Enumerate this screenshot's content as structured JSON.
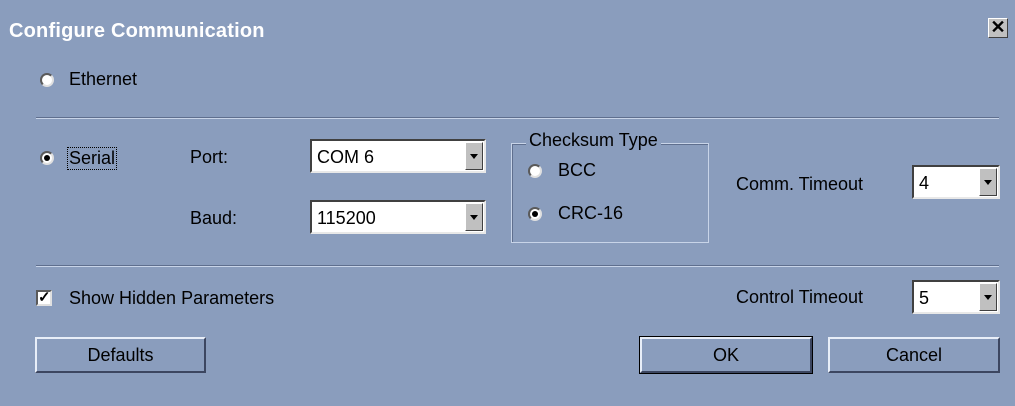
{
  "window": {
    "title": "Configure Communication",
    "close_glyph": "✕"
  },
  "connection": {
    "ethernet_label": "Ethernet",
    "serial_label": "Serial",
    "selected": "Serial"
  },
  "serial": {
    "port_label": "Port:",
    "port_value": "COM 6",
    "baud_label": "Baud:",
    "baud_value": "115200"
  },
  "checksum": {
    "legend": "Checksum Type",
    "bcc_label": "BCC",
    "crc_label": "CRC-16",
    "selected": "CRC-16"
  },
  "comm_timeout": {
    "label": "Comm. Timeout",
    "value": "4"
  },
  "hidden_params": {
    "label": "Show Hidden Parameters",
    "checked": true
  },
  "control_timeout": {
    "label": "Control Timeout",
    "value": "5"
  },
  "buttons": {
    "defaults": "Defaults",
    "ok": "OK",
    "cancel": "Cancel"
  },
  "colors": {
    "dialog_bg": "#8a9dbd",
    "title_text": "#ffffff",
    "field_bg": "#ffffff"
  }
}
